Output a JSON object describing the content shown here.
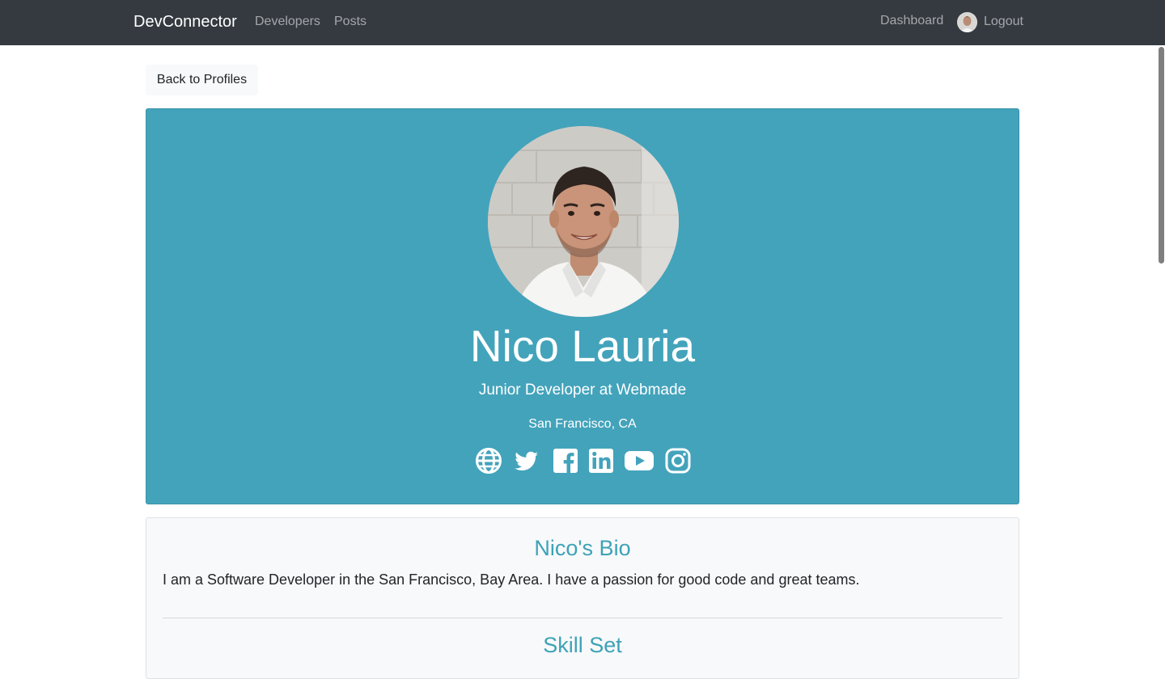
{
  "navbar": {
    "brand": "DevConnector",
    "links": {
      "developers": "Developers",
      "posts": "Posts",
      "dashboard": "Dashboard",
      "logout": "Logout"
    }
  },
  "back_button": {
    "label": "Back to Profiles"
  },
  "profile": {
    "name": "Nico Lauria",
    "title": "Junior Developer at Webmade",
    "location": "San Francisco, CA",
    "social_icons": [
      "globe-icon",
      "twitter-icon",
      "facebook-icon",
      "linkedin-icon",
      "youtube-icon",
      "instagram-icon"
    ]
  },
  "bio": {
    "heading": "Nico's Bio",
    "text": "I am a Software Developer in the San Francisco, Bay Area. I have a passion for good code and great teams."
  },
  "skills": {
    "heading": "Skill Set"
  },
  "colors": {
    "navbar_bg": "#343a40",
    "hero_bg": "#43a3bb",
    "accent_text": "#3ea2b8",
    "card_bg": "#f8f9fa"
  }
}
